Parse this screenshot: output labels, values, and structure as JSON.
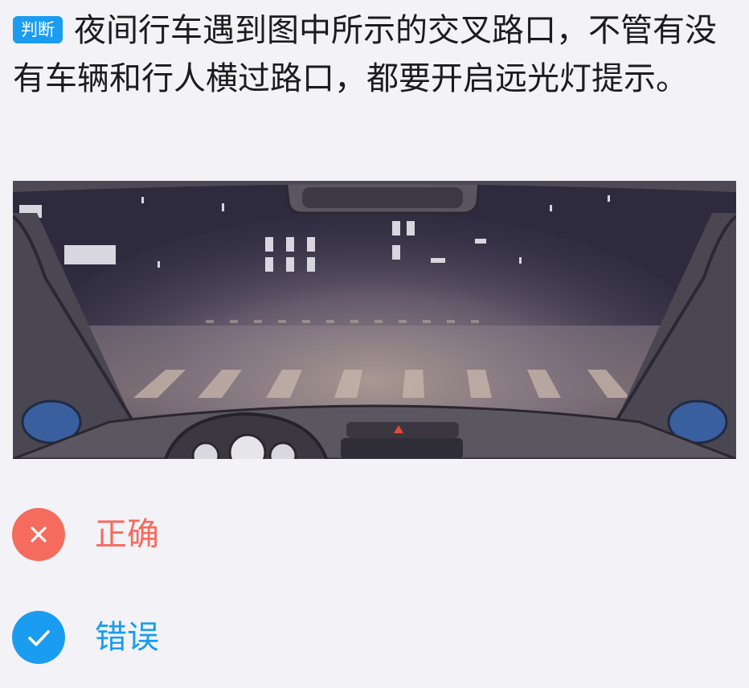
{
  "question": {
    "type_badge": "判断",
    "text": "夜间行车遇到图中所示的交叉路口，不管有没有车辆和行人横过路口，都要开启远光灯提示。"
  },
  "options": [
    {
      "label": "正确",
      "icon": "x-icon",
      "state": "wrong-choice",
      "color": "#f56b5e"
    },
    {
      "label": "错误",
      "icon": "check-icon",
      "state": "correct-answer",
      "color": "#1a9cf0"
    }
  ],
  "colors": {
    "background": "#f3f2f7",
    "accent_blue": "#1a9cf0",
    "wrong_red": "#f56b5e",
    "text": "#1c1c1e"
  }
}
